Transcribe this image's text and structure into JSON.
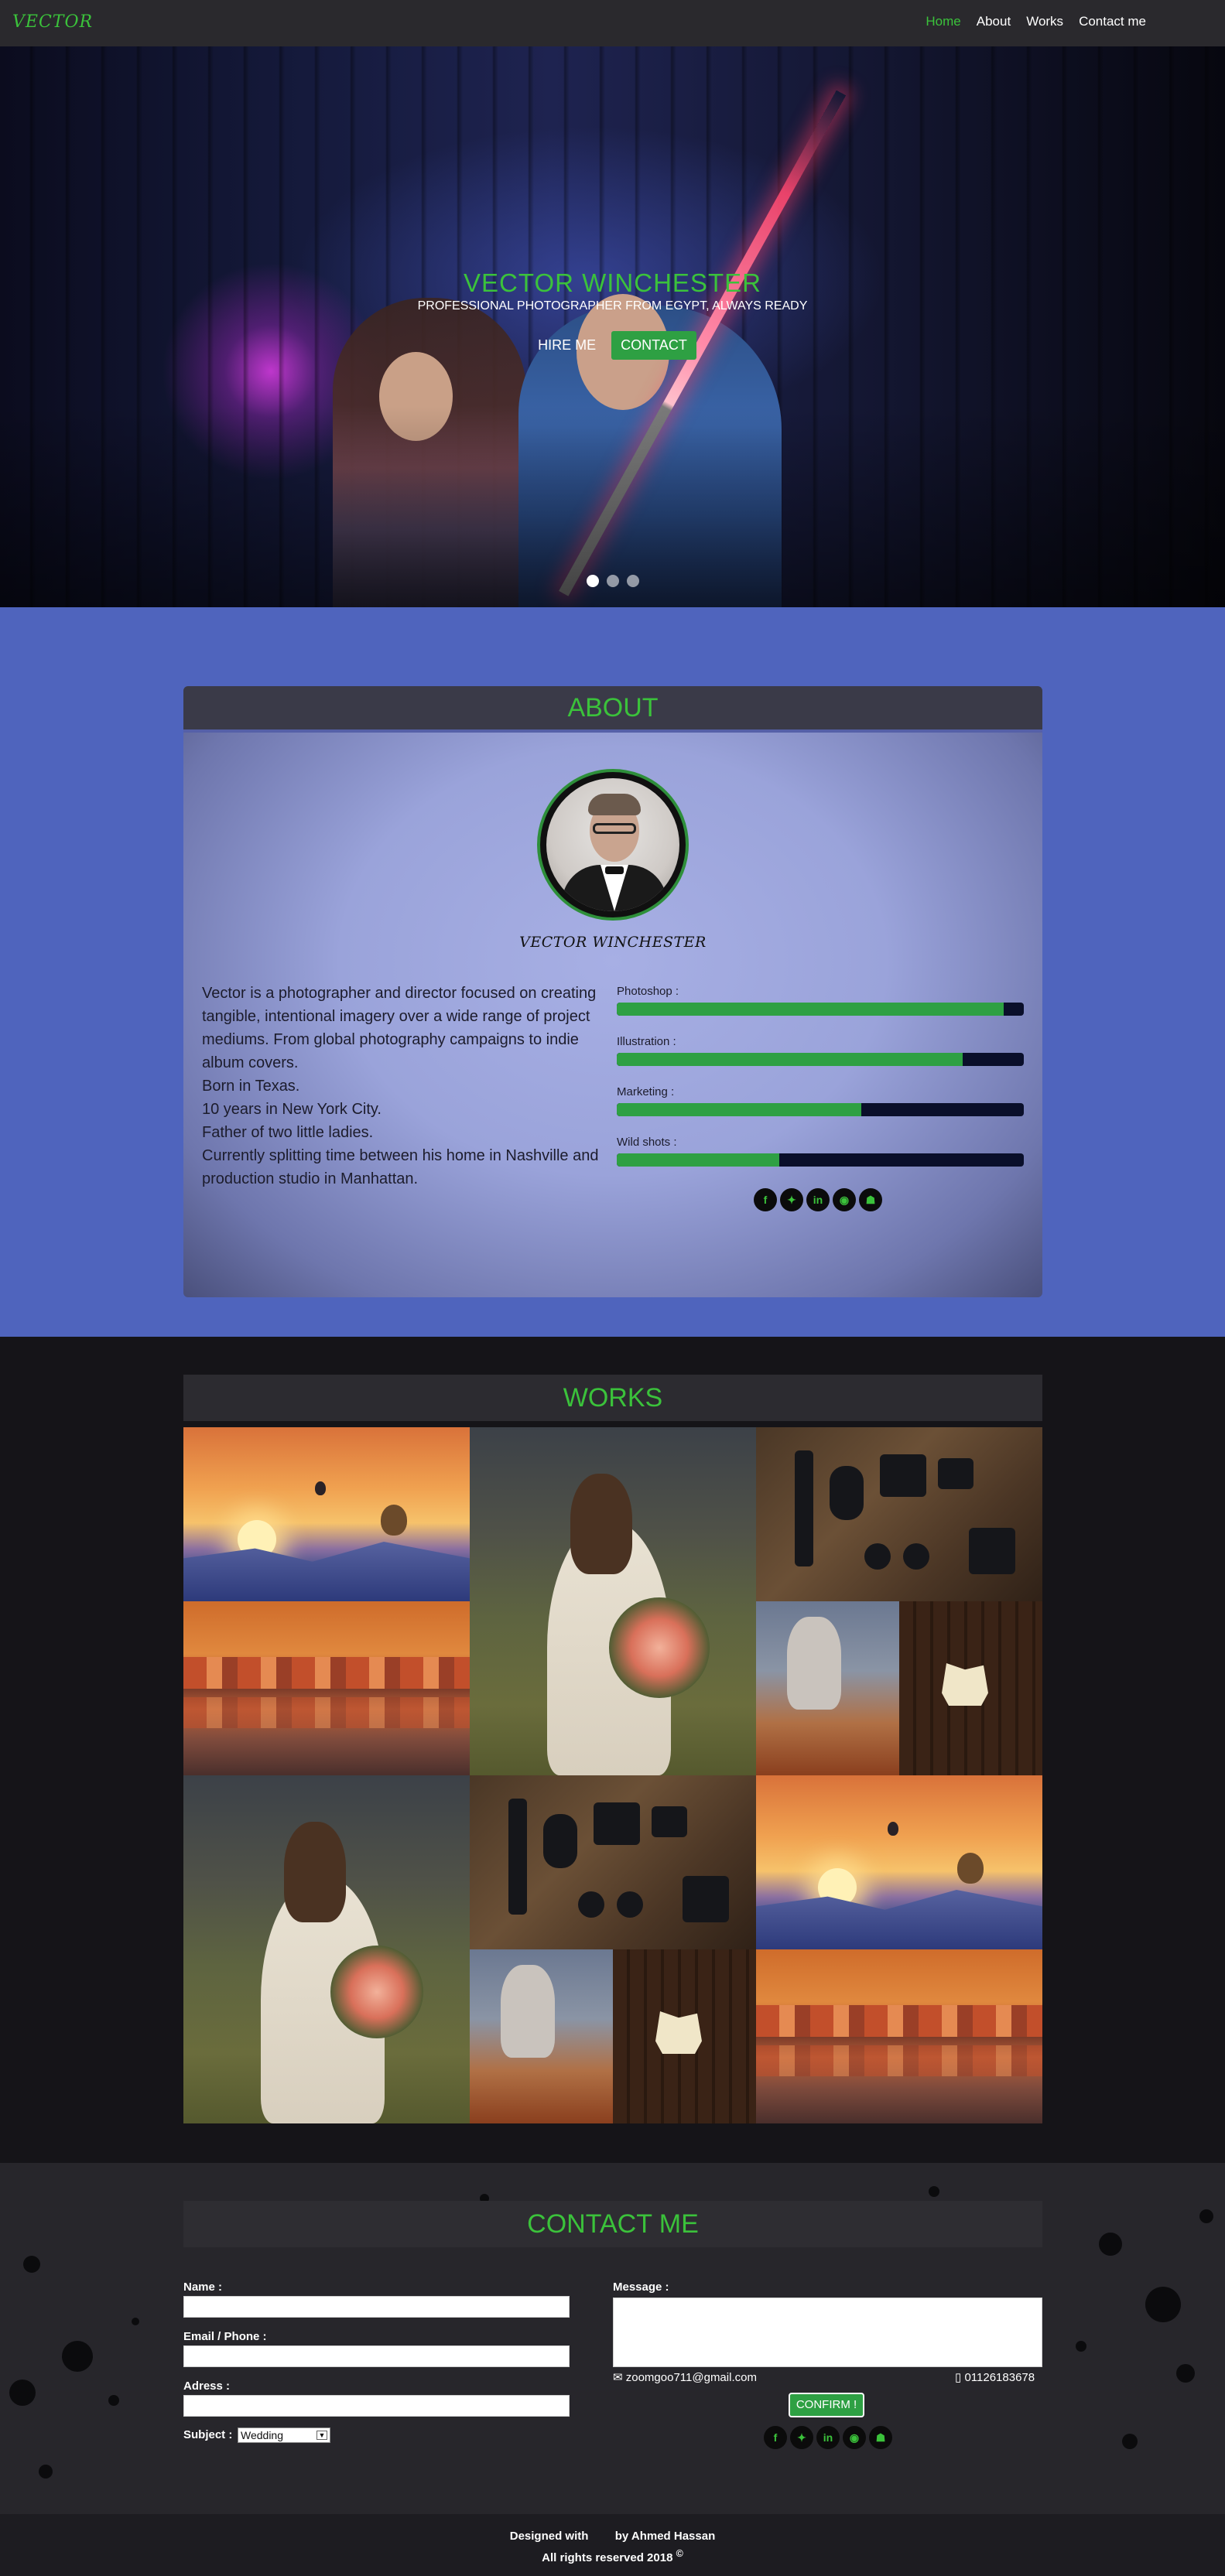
{
  "nav": {
    "logo": "VECTOR",
    "links": [
      "Home",
      "About",
      "Works",
      "Contact me"
    ],
    "active": "Home"
  },
  "hero": {
    "title": "VECTOR WINCHESTER",
    "subtitle": "PROFESSIONAL PHOTOGRAPHER FROM EGYPT, ALWAYS READY",
    "hire_label": "HIRE ME",
    "contact_label": "CONTACT",
    "slides": 3,
    "active_slide": 1
  },
  "about": {
    "heading": "ABOUT",
    "name": "VECTOR WINCHESTER",
    "bio": [
      "Vector is a photographer and director focused on creating tangible, intentional imagery over a wide range of project mediums. From global photography campaigns to indie album covers.",
      "Born in Texas.",
      "10 years in New York City.",
      "Father of two little ladies.",
      "Currently splitting time between his home in Nashville and production studio in Manhattan."
    ],
    "skills": [
      {
        "label": "Photoshop :",
        "level": 0.95
      },
      {
        "label": "Illustration :",
        "level": 0.85
      },
      {
        "label": "Marketing :",
        "level": 0.6
      },
      {
        "label": "Wild shots :",
        "level": 0.4
      }
    ],
    "social_icons": [
      "facebook-icon",
      "twitter-icon",
      "linkedin-icon",
      "instagram-icon",
      "snapchat-icon"
    ]
  },
  "works": {
    "heading": "WORKS"
  },
  "contact": {
    "heading": "CONTACT ME",
    "name_label": "Name :",
    "email_label": "Email / Phone :",
    "address_label": "Adress :",
    "subject_label": "Subject :",
    "subject_value": "Wedding",
    "message_label": "Message :",
    "email": "zoomgoo711@gmail.com",
    "phone": "01126183678",
    "confirm_label": "CONFIRM !"
  },
  "footer": {
    "designed_with": "Designed with",
    "by": "by Ahmed Hassan",
    "rights": "All rights reserved 2018"
  },
  "colors": {
    "accent": "#3bc23b",
    "about_bg": "#4f64bd",
    "nav_bg": "#2a292d",
    "dark_bg": "#151418"
  }
}
